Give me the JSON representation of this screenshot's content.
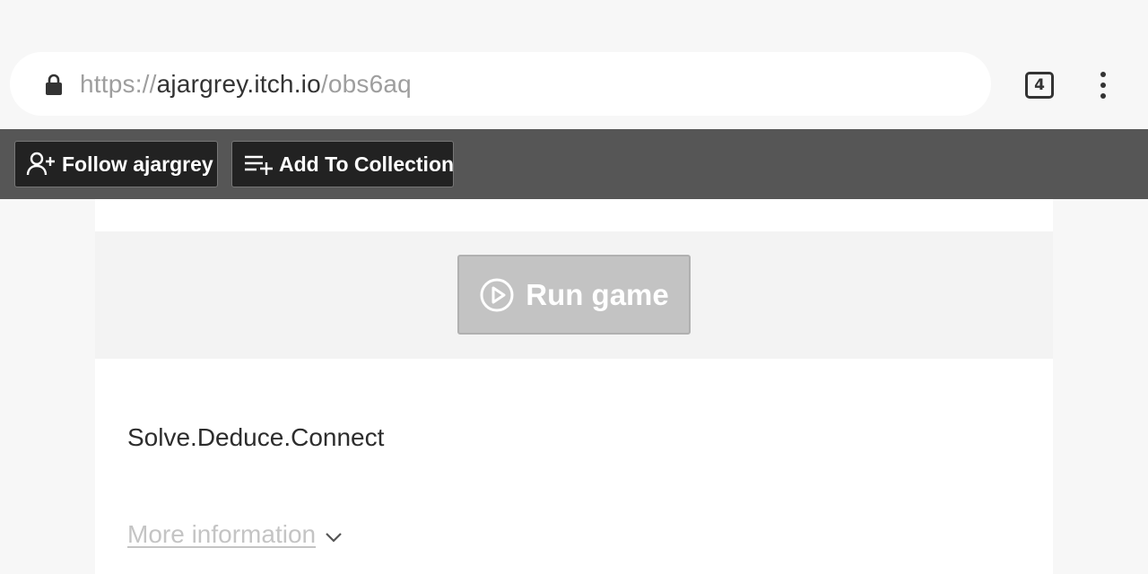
{
  "browser": {
    "url": {
      "scheme": "https://",
      "host": "ajargrey.itch.io",
      "path": "/obs6aq"
    },
    "tab_count": "4",
    "icons": [
      "lock-icon",
      "tabs-icon",
      "kebab-menu-icon"
    ]
  },
  "itch_bar": {
    "follow_label": "Follow ajargrey",
    "collection_label": "Add To Collection",
    "icons": [
      "user-plus-icon",
      "playlist-add-icon"
    ],
    "background": "#565656",
    "button_background": "#222222"
  },
  "game": {
    "run_label": "Run game",
    "run_icon": "play-circle-icon",
    "button_color": "#c3c3c3"
  },
  "description": {
    "tagline": "Solve.Deduce.Connect",
    "more_info_label": "More information",
    "more_info_icon": "chevron-down-icon"
  }
}
